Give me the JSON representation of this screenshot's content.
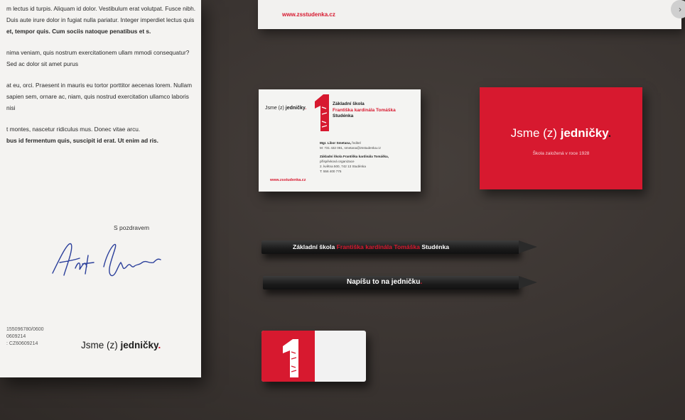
{
  "letterhead": {
    "paragraphs": [
      "m lectus id turpis. Aliquam id dolor. Vestibulum erat volutpat. Fusce nibh. Duis aute irure dolor in fugiat nulla pariatur. Integer imperdiet lectus quis",
      "et, tempor quis. Cum sociis natoque penatibus et s.",
      "nima veniam, quis nostrum exercitationem ullam mmodi consequatur? Sed ac dolor sit amet purus",
      "at eu, orci. Praesent in mauris eu tortor porttitor aecenas lorem. Nullam sapien sem, ornare ac, niam, quis nostrud exercitation ullamco laboris nisi",
      "t montes, nascetur ridiculus mus. Donec vitae arcu.",
      "bus id fermentum quis, suscipit id erat. Ut enim ad ris."
    ],
    "greeting": "S pozdravem",
    "footer_lines": [
      "155096780/0600",
      "0609214",
      ": CZ60609214"
    ],
    "logo": {
      "pre": "Jsme ",
      "mid": "(z) ",
      "bold": "jedničky",
      "dot": "."
    }
  },
  "top_sheet": {
    "url": "www.zsstudenka.cz"
  },
  "business_card": {
    "logo": {
      "pre": "Jsme ",
      "mid": "(z) ",
      "bold": "jedničky",
      "dot": "."
    },
    "school_line1": "Základní škola",
    "school_line2": "Františka kardinála Tomáška",
    "school_line3": "Studénka",
    "person": "Mgr. Libor Smetana,",
    "role": " ředitel",
    "phone": "M: 731 432 081, smetana@zsstudenka.cz",
    "org_line1": "Základní škola Františka kardinála Tomáška,",
    "org_line2": "příspěvková organizace",
    "org_line3": "2. května 500, 742 13 Studénka",
    "tel": "T: 556 400 775",
    "url": "www.zsstudenka.cz"
  },
  "red_card": {
    "title_pre": "Jsme ",
    "title_mid": "(z) ",
    "title_bold": "jedničky",
    "title_dot": ".",
    "subtitle": "Škola založená v roce 1928"
  },
  "pencil1": {
    "part1": "Základní škola ",
    "part2": "Františka kardinála Tomáška",
    "part3": " Studénka"
  },
  "pencil2": {
    "text": "Napíšu to na jedničku",
    "dot": "."
  },
  "colors": {
    "brand_red": "#d7192f",
    "background": "#3b3532",
    "paper": "#f4f3f1"
  }
}
